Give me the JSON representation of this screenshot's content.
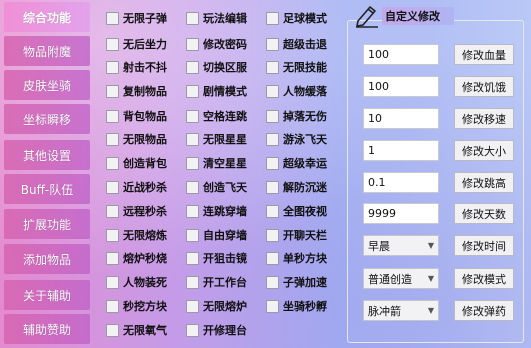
{
  "sidebar": {
    "items": [
      {
        "label": "综合功能"
      },
      {
        "label": "物品附魔"
      },
      {
        "label": "皮肤坐骑"
      },
      {
        "label": "坐标瞬移"
      },
      {
        "label": "其他设置"
      },
      {
        "label": "Buff-队伍"
      },
      {
        "label": "扩展功能"
      },
      {
        "label": "添加物品"
      },
      {
        "label": "关于辅助"
      },
      {
        "label": "辅助赞助"
      }
    ]
  },
  "cheats": {
    "col1": [
      "无限子弹",
      "无后坐力",
      "射击不抖",
      "复制物品",
      "背包物品",
      "无限物品",
      "创造背包",
      "近战秒杀",
      "远程秒杀",
      "无限熔炼",
      "熔炉秒烧",
      "人物装死",
      "秒挖方块",
      "无限氧气"
    ],
    "col2": [
      "玩法编辑",
      "修改密码",
      "切换区服",
      "剧情模式",
      "空格连跳",
      "无限星星",
      "清空星星",
      "创造飞天",
      "连跳穿墙",
      "自由穿墙",
      "开狙击镜",
      "开工作台",
      "无限熔炉",
      "开修理台"
    ],
    "col3": [
      "足球模式",
      "超级击退",
      "无限技能",
      "人物缓落",
      "掉落无伤",
      "游泳飞天",
      "超级幸运",
      "解防沉迷",
      "全图夜视",
      "开聊天栏",
      "单秒方块",
      "子弹加速",
      "坐骑秒孵"
    ]
  },
  "panel": {
    "title": "自定义修改",
    "rows": [
      {
        "type": "input",
        "value": "100",
        "button": "修改血量"
      },
      {
        "type": "input",
        "value": "100",
        "button": "修改饥饿"
      },
      {
        "type": "input",
        "value": "10",
        "button": "修改移速"
      },
      {
        "type": "input",
        "value": "1",
        "button": "修改大小"
      },
      {
        "type": "input",
        "value": "0.1",
        "button": "修改跳高"
      },
      {
        "type": "input",
        "value": "9999",
        "button": "修改天数"
      },
      {
        "type": "select",
        "value": "早晨",
        "button": "修改时间"
      },
      {
        "type": "select",
        "value": "普通创造",
        "button": "修改模式"
      },
      {
        "type": "select",
        "value": "脉冲箭",
        "button": "修改弹药"
      }
    ]
  }
}
